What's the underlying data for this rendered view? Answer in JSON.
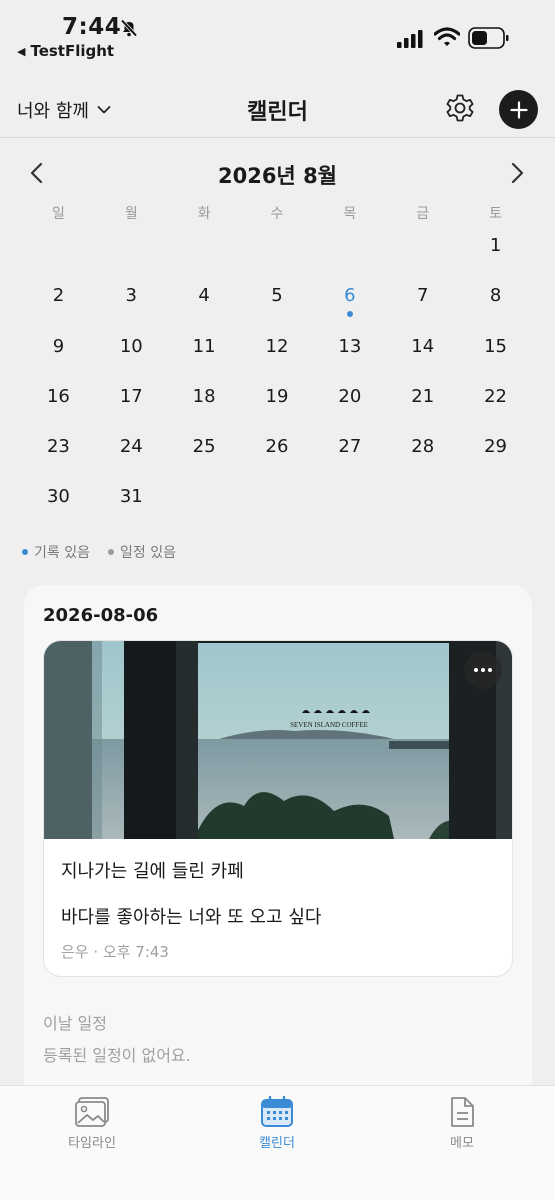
{
  "status_bar": {
    "time": "7:44",
    "back_app": "TestFlight"
  },
  "header": {
    "partner_label": "너와 함께",
    "title": "캘린더"
  },
  "calendar": {
    "month_label": "2026년 8월",
    "weekdays": [
      "일",
      "월",
      "화",
      "수",
      "목",
      "금",
      "토"
    ],
    "days": [
      "",
      "",
      "",
      "",
      "",
      "",
      "1",
      "2",
      "3",
      "4",
      "5",
      "6",
      "7",
      "8",
      "9",
      "10",
      "11",
      "12",
      "13",
      "14",
      "15",
      "16",
      "17",
      "18",
      "19",
      "20",
      "21",
      "22",
      "23",
      "24",
      "25",
      "26",
      "27",
      "28",
      "29",
      "30",
      "31",
      "",
      "",
      "",
      "",
      ""
    ],
    "selected_day": "6",
    "record_days": [
      "6"
    ]
  },
  "legend": {
    "record": "기록 있음",
    "schedule": "일정 있음",
    "record_color": "#3b8bd4",
    "schedule_color": "#9a9a9a"
  },
  "record": {
    "date": "2026-08-06",
    "title": "지나가는 길에 들린 카페",
    "body": "바다를 좋아하는 너와 또 오고 싶다",
    "meta": "은우 · 오후 7:43",
    "photo_sign": "SEVEN ISLAND COFFEE"
  },
  "schedule": {
    "label": "이날 일정",
    "empty": "등록된 일정이 없어요."
  },
  "tabs": [
    {
      "label": "타임라인",
      "icon": "image-icon"
    },
    {
      "label": "캘린더",
      "icon": "calendar-icon"
    },
    {
      "label": "메모",
      "icon": "document-icon"
    }
  ],
  "colors": {
    "accent": "#3b8bd4",
    "dark_button": "#1c1c1e"
  }
}
